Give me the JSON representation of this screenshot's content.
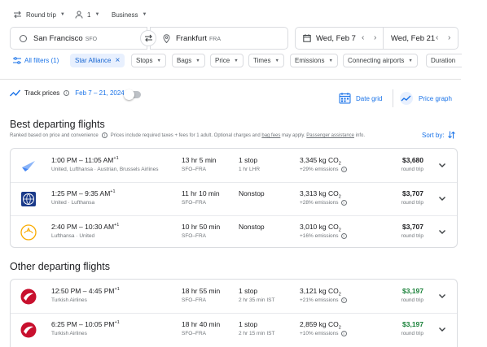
{
  "trip_options": {
    "trip_type": "Round trip",
    "passengers": "1",
    "cabin": "Business"
  },
  "search": {
    "origin_city": "San Francisco",
    "origin_code": "SFO",
    "destination_city": "Frankfurt",
    "destination_code": "FRA",
    "depart_date": "Wed, Feb 7",
    "return_date": "Wed, Feb 21"
  },
  "filters": {
    "all_filters": "All filters (1)",
    "chips": [
      "Star Alliance",
      "Stops",
      "Bags",
      "Price",
      "Times",
      "Emissions",
      "Connecting airports",
      "Duration"
    ]
  },
  "tracking": {
    "label": "Track prices",
    "date_range": "Feb 7 – 21, 2024",
    "date_grid": "Date grid",
    "price_graph": "Price graph"
  },
  "best_section": {
    "title": "Best departing flights",
    "subtitle": "Ranked based on price and convenience",
    "fee_note_prefix": "Prices include required taxes + fees for 1 adult. Optional charges and ",
    "bag_fees_link": "bag fees",
    "fee_note_middle": " may apply. ",
    "passenger_assistance_link": "Passenger assistance",
    "fee_note_suffix": " info.",
    "sort_label": "Sort by:"
  },
  "other_section": {
    "title": "Other departing flights"
  },
  "flights_best": [
    {
      "logo": "star-alliance-logo",
      "times": "1:00 PM – 11:05 AM",
      "days": "+1",
      "airline": "United, Lufthansa · Austrian, Brussels Airlines",
      "duration": "13 hr 5 min",
      "route": "SFO–FRA",
      "stops": "1 stop",
      "layover": "1 hr LHR",
      "co2": "3,345 kg CO",
      "co2_sub": "2",
      "emissions": "+29% emissions",
      "price": "$3,680",
      "price_type": "round trip",
      "price_color": "#202124"
    },
    {
      "logo": "united-logo",
      "times": "1:25 PM – 9:35 AM",
      "days": "+1",
      "airline": "United · Lufthansa",
      "duration": "11 hr 10 min",
      "route": "SFO–FRA",
      "stops": "Nonstop",
      "layover": "",
      "co2": "3,313 kg CO",
      "co2_sub": "2",
      "emissions": "+28% emissions",
      "price": "$3,707",
      "price_type": "round trip",
      "price_color": "#202124"
    },
    {
      "logo": "lufthansa-logo",
      "times": "2:40 PM – 10:30 AM",
      "days": "+1",
      "airline": "Lufthansa · United",
      "duration": "10 hr 50 min",
      "route": "SFO–FRA",
      "stops": "Nonstop",
      "layover": "",
      "co2": "3,010 kg CO",
      "co2_sub": "2",
      "emissions": "+16% emissions",
      "price": "$3,707",
      "price_type": "round trip",
      "price_color": "#202124"
    }
  ],
  "flights_other": [
    {
      "logo": "turkish-airlines-logo",
      "times": "12:50 PM – 4:45 PM",
      "days": "+1",
      "airline": "Turkish Airlines",
      "duration": "18 hr 55 min",
      "route": "SFO–FRA",
      "stops": "1 stop",
      "layover": "2 hr 35 min IST",
      "co2": "3,121 kg CO",
      "co2_sub": "2",
      "emissions": "+21% emissions",
      "price": "$3,197",
      "price_type": "round trip",
      "price_color": "#188038"
    },
    {
      "logo": "turkish-airlines-logo",
      "times": "6:25 PM – 10:05 PM",
      "days": "+1",
      "airline": "Turkish Airlines",
      "duration": "18 hr 40 min",
      "route": "SFO–FRA",
      "stops": "1 stop",
      "layover": "2 hr 15 min IST",
      "co2": "2,859 kg CO",
      "co2_sub": "2",
      "emissions": "+10% emissions",
      "price": "$3,197",
      "price_type": "round trip",
      "price_color": "#188038"
    }
  ],
  "colors": {
    "accent": "#1a73e8",
    "cheap_price": "#188038",
    "chip_active_bg": "#e8f0fe"
  }
}
